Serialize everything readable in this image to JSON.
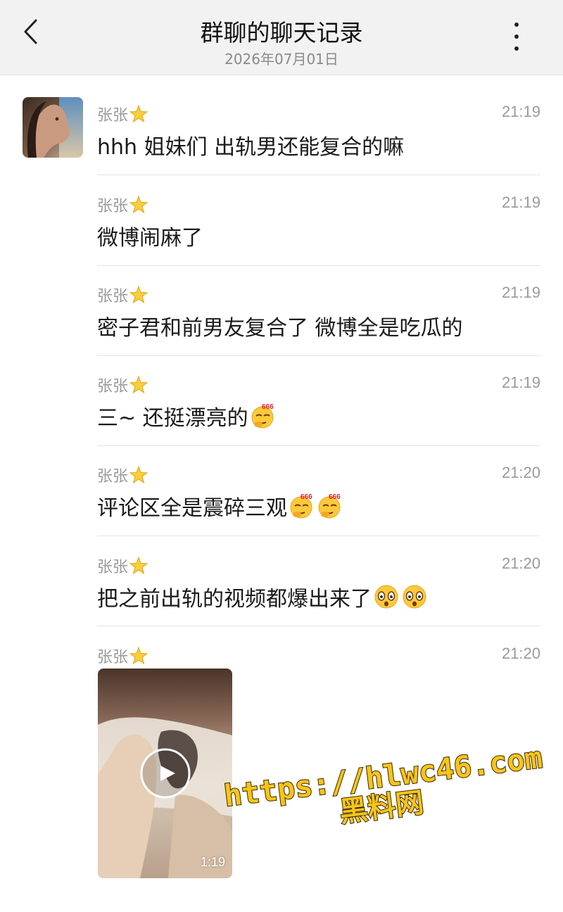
{
  "header": {
    "title": "群聊的聊天记录",
    "date": "2026年07月01日"
  },
  "messages": [
    {
      "sender": "张张",
      "time": "21:19",
      "text": "hhh 姐妹们 出轨男还能复合的嘛",
      "emojis": []
    },
    {
      "sender": "张张",
      "time": "21:19",
      "text": "微博闹麻了",
      "emojis": []
    },
    {
      "sender": "张张",
      "time": "21:19",
      "text": "密子君和前男友复合了 微博全是吃瓜的",
      "emojis": []
    },
    {
      "sender": "张张",
      "time": "21:19",
      "text": "三~ 还挺漂亮的",
      "emojis": [
        "666-emoji"
      ]
    },
    {
      "sender": "张张",
      "time": "21:20",
      "text": "评论区全是震碎三观",
      "emojis": [
        "666-emoji",
        "666-emoji"
      ]
    },
    {
      "sender": "张张",
      "time": "21:20",
      "text": "把之前出轨的视频都爆出来了",
      "emojis": [
        "shocked-emoji",
        "shocked-emoji"
      ]
    },
    {
      "sender": "张张",
      "time": "21:20",
      "text": "",
      "emojis": []
    }
  ],
  "video": {
    "duration": "1:19"
  },
  "watermark": {
    "url": "https://hlwc46.com",
    "brand": "黑料网"
  },
  "colors": {
    "header_bg": "#f2f2f2",
    "meta_text": "#9a9a9a",
    "watermark": "#f6c41a"
  }
}
